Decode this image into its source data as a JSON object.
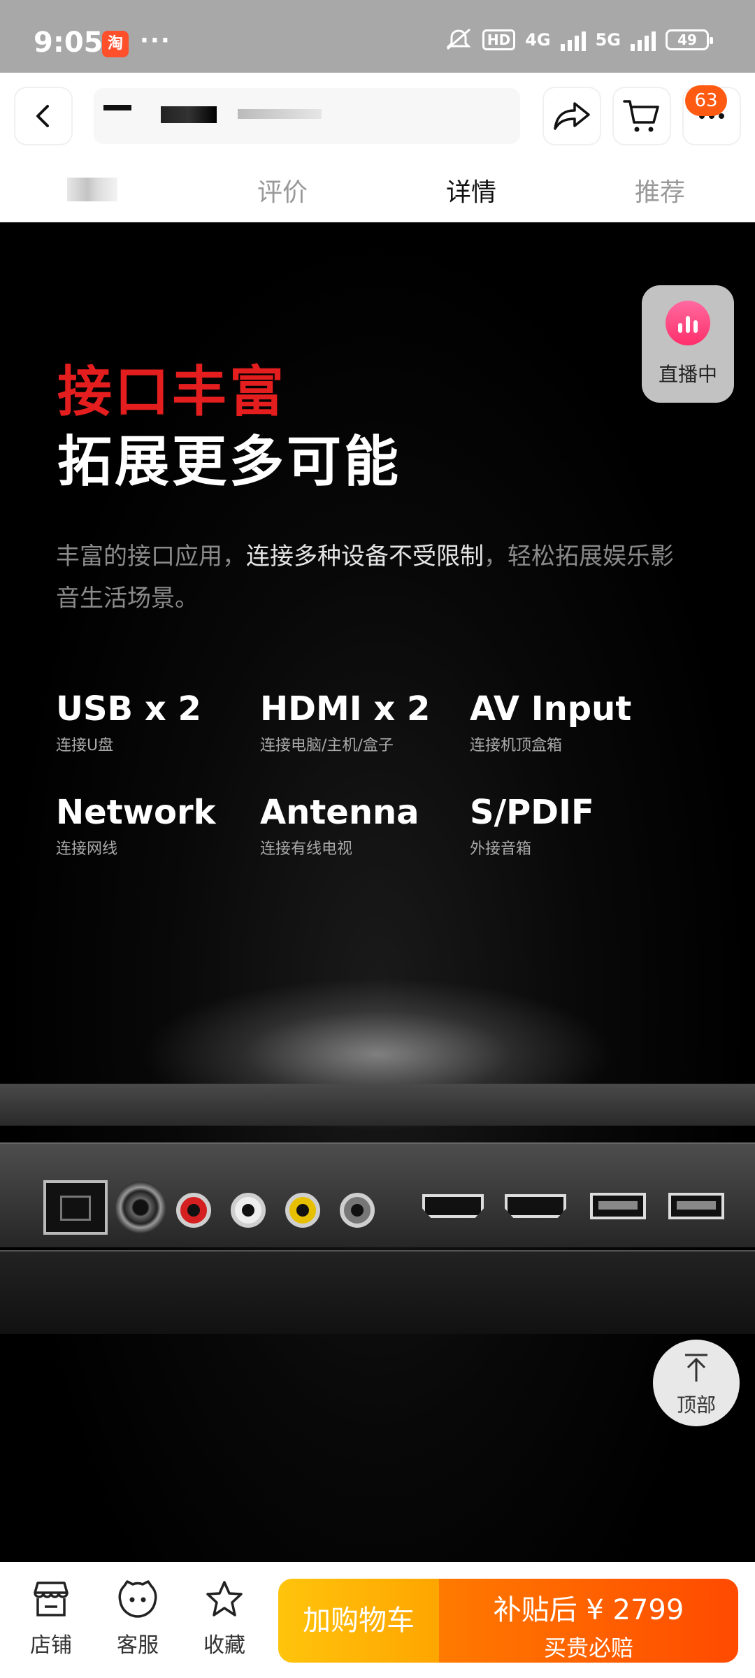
{
  "status": {
    "time": "9:05",
    "app_badge": "淘",
    "more": "···",
    "hd": "HD",
    "net1": "4G",
    "net2": "5G",
    "battery": "49"
  },
  "nav": {
    "cart_badge": "63"
  },
  "tabs": [
    {
      "label": ""
    },
    {
      "label": "评价"
    },
    {
      "label": "详情"
    },
    {
      "label": "推荐"
    }
  ],
  "detail": {
    "headline_red": "接口丰富",
    "headline_white": "拓展更多可能",
    "desc_part1": "丰富的接口应用，",
    "desc_highlight": "连接多种设备不受限制",
    "desc_part2": "，轻松拓展娱乐影音生活场景。",
    "ports": [
      {
        "name": "USB x 2",
        "sub": "连接U盘"
      },
      {
        "name": "HDMI x 2",
        "sub": "连接电脑/主机/盒子"
      },
      {
        "name": "AV Input",
        "sub": "连接机顶盒箱"
      },
      {
        "name": "Network",
        "sub": "连接网线"
      },
      {
        "name": "Antenna",
        "sub": "连接有线电视"
      },
      {
        "name": "S/PDIF",
        "sub": "外接音箱"
      }
    ]
  },
  "live": {
    "label": "直播中"
  },
  "to_top": {
    "label": "顶部"
  },
  "bottom": {
    "shop": "店铺",
    "service": "客服",
    "favorite": "收藏",
    "add_cart": "加购物车",
    "buy_line1": "补贴后 ¥ 2799",
    "buy_line2": "买贵必赔"
  },
  "colors": {
    "accent_red": "#e41e1e",
    "cart_orange": "#ffa500",
    "buy_orange": "#ff4a00"
  }
}
